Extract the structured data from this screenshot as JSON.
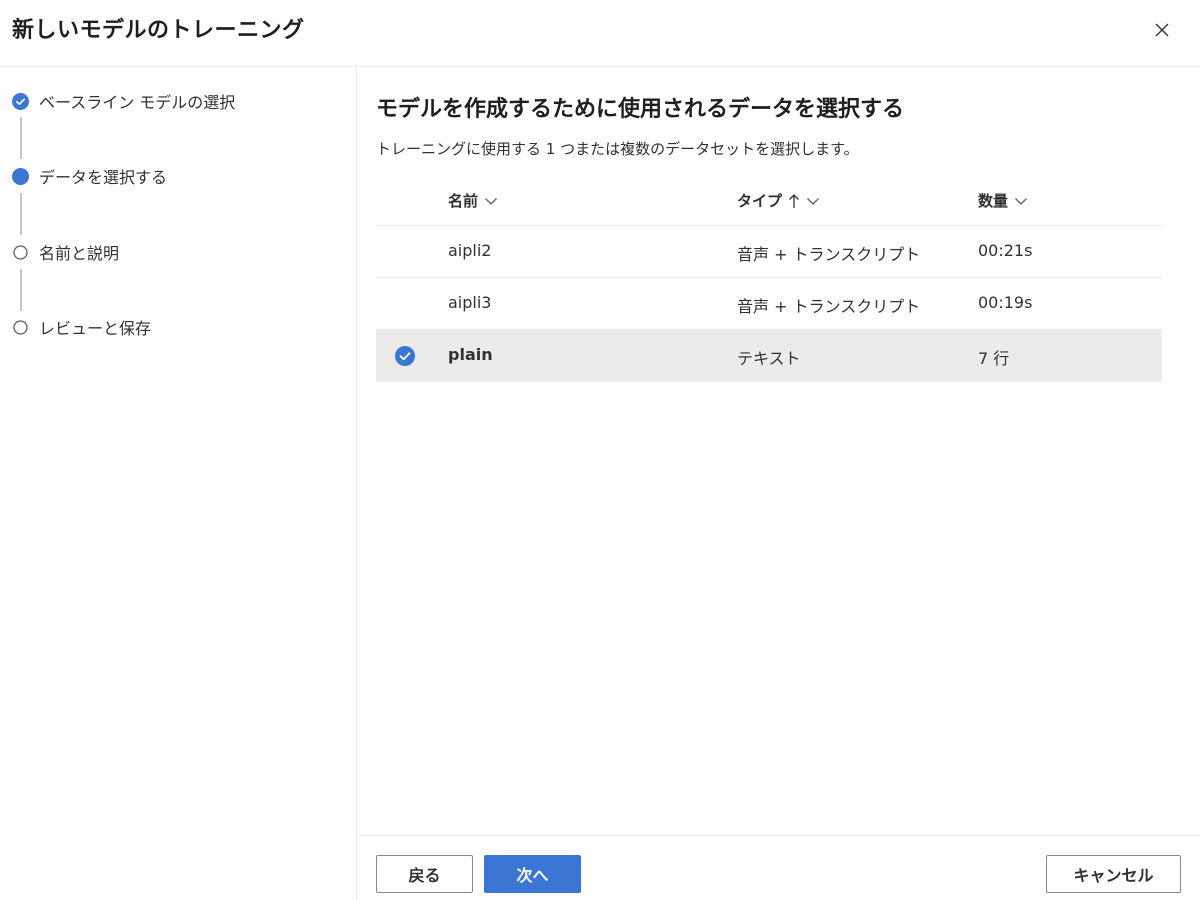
{
  "dialog": {
    "title": "新しいモデルのトレーニング"
  },
  "steps": [
    {
      "label": "ベースライン モデルの選択",
      "state": "completed"
    },
    {
      "label": "データを選択する",
      "state": "current"
    },
    {
      "label": "名前と説明",
      "state": "pending"
    },
    {
      "label": "レビューと保存",
      "state": "pending"
    }
  ],
  "main": {
    "title": "モデルを作成するために使用されるデータを選択する",
    "description": "トレーニングに使用する 1 つまたは複数のデータセットを選択します。"
  },
  "table": {
    "columns": [
      {
        "label": "名前",
        "sort": "none"
      },
      {
        "label": "タイプ",
        "sort": "ascending"
      },
      {
        "label": "数量",
        "sort": "none"
      }
    ],
    "rows": [
      {
        "name": "aipli2",
        "type": "音声 + トランスクリプト",
        "quantity": "00:21s",
        "selected": false
      },
      {
        "name": "aipli3",
        "type": "音声 + トランスクリプト",
        "quantity": "00:19s",
        "selected": false
      },
      {
        "name": "plain",
        "type": "テキスト",
        "quantity": "7 行",
        "selected": true
      }
    ]
  },
  "footer": {
    "back_label": "戻る",
    "next_label": "次へ",
    "cancel_label": "キャンセル"
  },
  "colors": {
    "accent": "#3b76d4",
    "selected_row": "#edebe9",
    "pending_step_border": "#605e5c"
  },
  "icons": {
    "close": "close-icon",
    "step_completed": "check-circle-icon",
    "step_current": "filled-circle-icon",
    "step_pending": "empty-circle-icon",
    "sort_ascending": "arrow-up-icon",
    "column_menu": "chevron-down-icon",
    "row_selected": "check-circle-icon"
  }
}
